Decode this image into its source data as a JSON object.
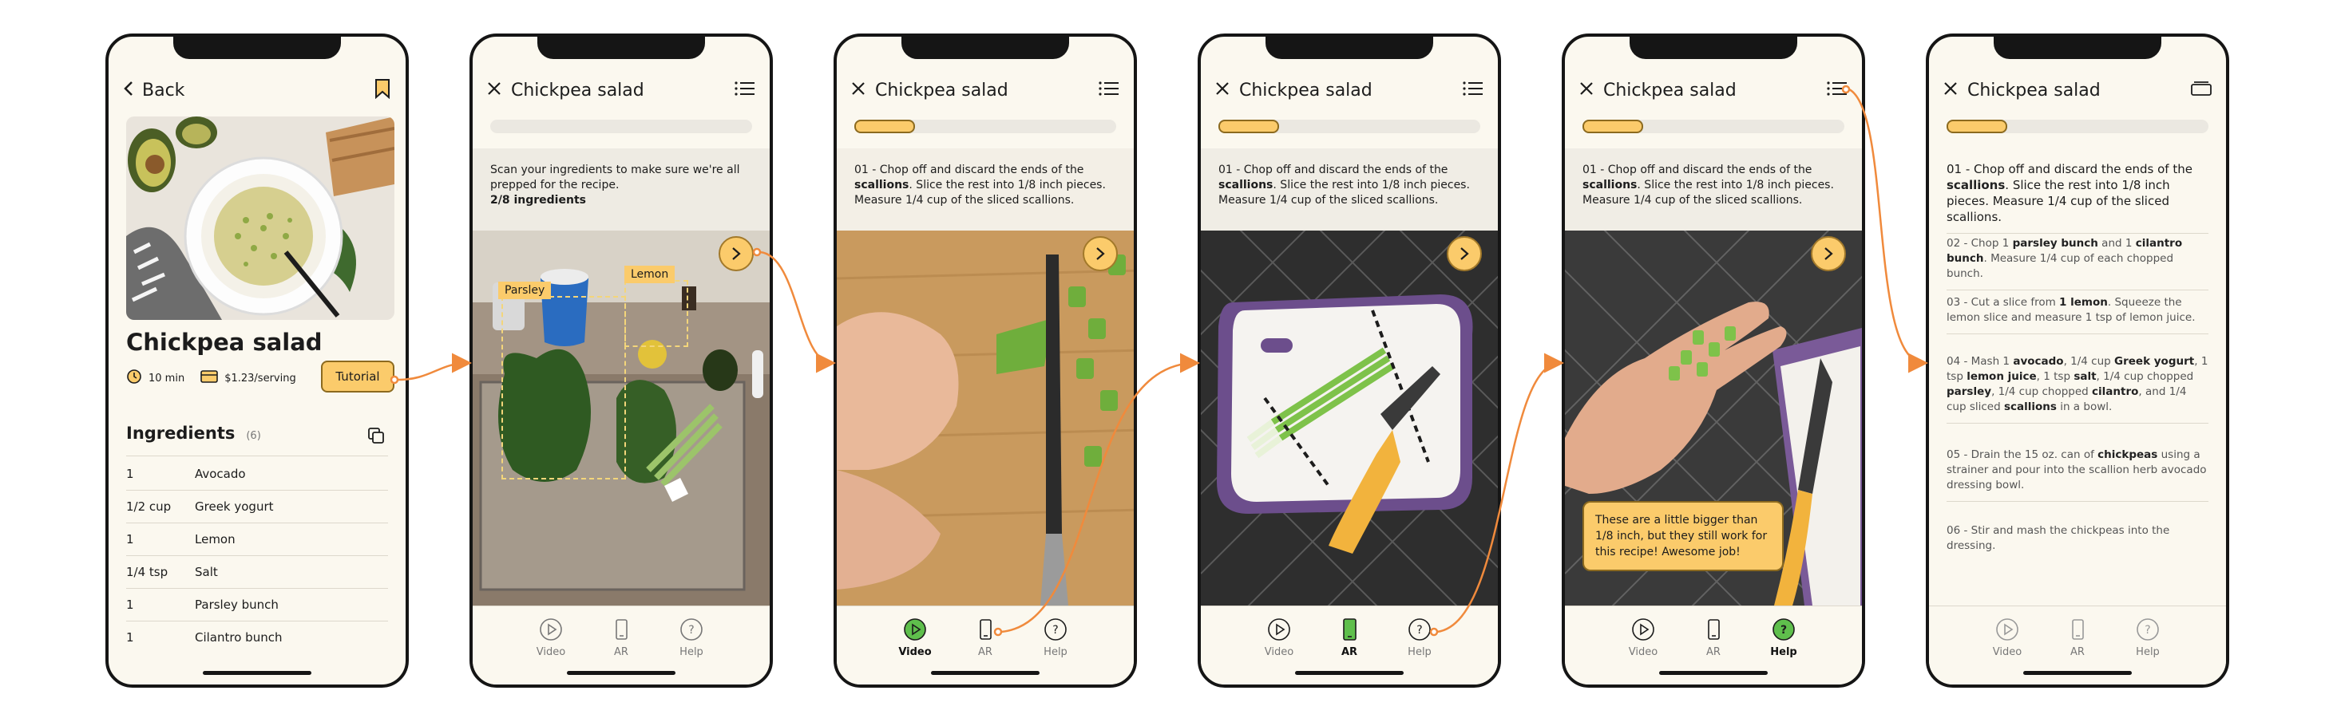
{
  "colors": {
    "accent": "#fbcb6b",
    "accent_border": "#8c6a1f",
    "active_tab": "#4caf50",
    "arrow": "#f08a3c",
    "screen_bg": "#fbf8ef"
  },
  "recipe_screen": {
    "back_label": "Back",
    "title": "Chickpea salad",
    "time": "10 min",
    "price": "$1.23/serving",
    "tutorial_button": "Tutorial",
    "ingredients_heading": "Ingredients",
    "ingredients_count": "(6)",
    "ingredients": [
      {
        "qty": "1",
        "name": "Avocado"
      },
      {
        "qty": "1/2 cup",
        "name": "Greek yogurt"
      },
      {
        "qty": "1",
        "name": "Lemon"
      },
      {
        "qty": "1/4 tsp",
        "name": "Salt"
      },
      {
        "qty": "1",
        "name": "Parsley bunch"
      },
      {
        "qty": "1",
        "name": "Cilantro bunch"
      }
    ]
  },
  "header_title": "Chickpea salad",
  "scan": {
    "text": "Scan your ingredients to make sure we're all prepped for the recipe.",
    "count": "2/8 ingredients",
    "labels": {
      "parsley": "Parsley",
      "lemon": "Lemon"
    }
  },
  "step1": {
    "prefix": "01 - Chop off and discard the ends of the",
    "bold": "scallions",
    "suffix": ". Slice the rest into 1/8 inch pieces. Measure 1/4 cup of the sliced scallions."
  },
  "toast": "These are a little bigger than 1/8 inch, but they still work for this recipe! Awesome job!",
  "tabs": {
    "video": "Video",
    "ar": "AR",
    "help": "Help"
  },
  "steps": [
    {
      "pre": "02 - Chop 1 ",
      "b1": "parsley bunch",
      "mid": " and 1 ",
      "b2": "cilantro bunch",
      "post": ". Measure 1/4 cup of each chopped bunch."
    },
    {
      "pre": "03 - Cut a slice from ",
      "b1": "1 lemon",
      "post": ". Squeeze the lemon slice and measure 1 tsp of lemon juice."
    },
    {
      "pre": "04 - Mash 1 ",
      "b1": "avocado",
      "t2": ", 1/4 cup ",
      "b2": "Greek yogurt",
      "t3": ", 1 tsp ",
      "b3": "lemon juice",
      "t4": ", 1 tsp ",
      "b4": "salt",
      "t5": ", 1/4 cup chopped ",
      "b5": "parsley",
      "t6": ", 1/4 cup chopped ",
      "b6": "cilantro",
      "t7": ", and 1/4 cup sliced ",
      "b7": "scallions",
      "post": " in a bowl."
    },
    {
      "pre": "05 - Drain the 15 oz. can of ",
      "b1": "chickpeas",
      "post": " using a strainer and pour into the scallion herb avocado dressing bowl."
    },
    {
      "pre": "06 - Stir and mash the chickpeas into the dressing."
    }
  ],
  "progress": {
    "scan": 0.0,
    "step": 0.22
  }
}
